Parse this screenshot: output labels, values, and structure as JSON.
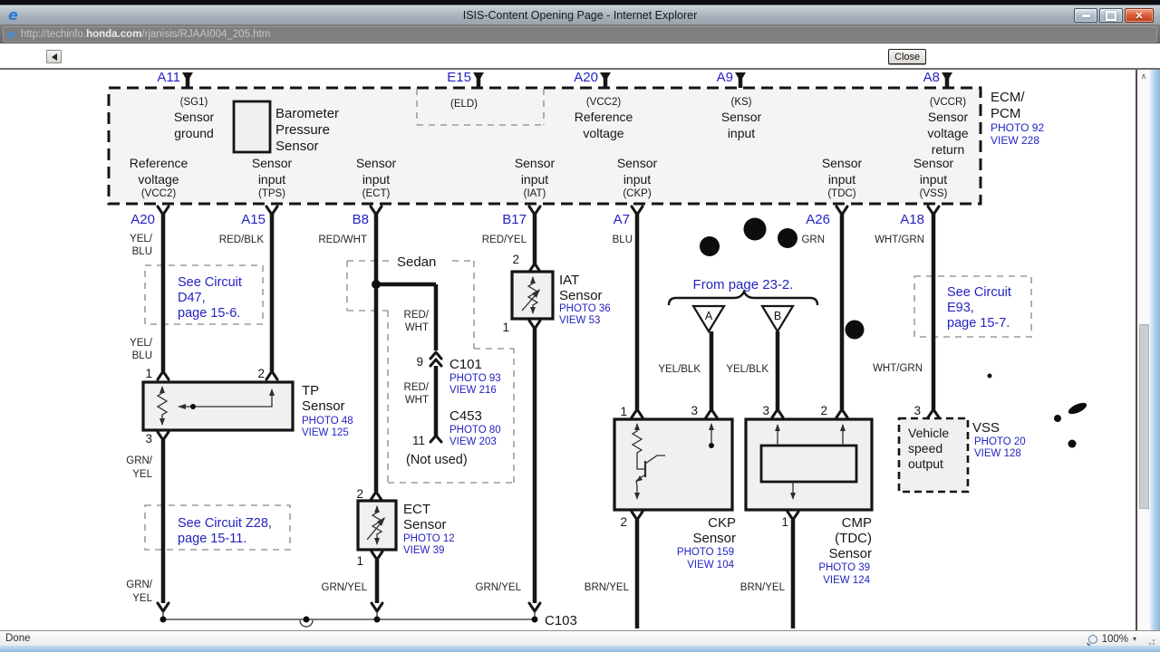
{
  "titlebar": {
    "title": "ISIS-Content Opening Page - Internet Explorer"
  },
  "addressbar": {
    "url_pre": "http://techinfo.",
    "url_domain": "honda.com",
    "url_path": "/rjanisis/RJAAI004_205.htm"
  },
  "toolbar": {
    "close": "Close"
  },
  "statusbar": {
    "done": "Done",
    "zoom": "100%"
  },
  "icons": {
    "ie": "e",
    "close": "✕",
    "scroll_up": "∧",
    "dropdown": "▾"
  },
  "ecm": {
    "title1": "ECM/",
    "title2": "PCM",
    "photo": "PHOTO 92",
    "view": "VIEW 228",
    "top_pins": [
      "A11",
      "E15",
      "A20",
      "A9",
      "A8"
    ],
    "bottom_pins": [
      "A20",
      "A15",
      "B8",
      "B17",
      "A7",
      "A26",
      "A18"
    ],
    "sg1": [
      "(SG1)",
      "Sensor",
      "ground"
    ],
    "baro": [
      "Barometer",
      "Pressure",
      "Sensor"
    ],
    "eld": "(ELD)",
    "vcc2_top": [
      "(VCC2)",
      "Reference",
      "voltage"
    ],
    "ks": [
      "(KS)",
      "Sensor",
      "input"
    ],
    "vccr": [
      "(VCCR)",
      "Sensor",
      "voltage",
      "return"
    ],
    "bottom_labels": [
      [
        "Reference",
        "voltage",
        "(VCC2)"
      ],
      [
        "Sensor",
        "input",
        "(TPS)"
      ],
      [
        "Sensor",
        "input",
        "(ECT)"
      ],
      [
        "Sensor",
        "input",
        "(IAT)"
      ],
      [
        "Sensor",
        "input",
        "(CKP)"
      ],
      [
        "Sensor",
        "input",
        "(TDC)"
      ],
      [
        "Sensor",
        "input",
        "(VSS)"
      ]
    ]
  },
  "wires": {
    "yel_blu": [
      "YEL/",
      "BLU"
    ],
    "red_blk": "RED/BLK",
    "red_wht": "RED/WHT",
    "red_yel": "RED/YEL",
    "blu": "BLU",
    "grn": "GRN",
    "wht_grn": "WHT/GRN",
    "yel_blk": "YEL/BLK",
    "red_wht2": [
      "RED/",
      "WHT"
    ],
    "grn_yel2": [
      "GRN/",
      "YEL"
    ],
    "grn_yel": "GRN/YEL",
    "brn_yel": "BRN/YEL"
  },
  "notes": {
    "d47": [
      "See Circuit",
      "D47,",
      "page 15-6."
    ],
    "z28": [
      "See Circuit Z28,",
      "page 15-11."
    ],
    "e93": [
      "See Circuit",
      "E93,",
      "page 15-7."
    ],
    "from_page": "From page 23-2.",
    "sedan": "Sedan",
    "not_used": "(Not used)"
  },
  "components": {
    "tp": {
      "l1": "TP",
      "l2": "Sensor",
      "photo": "PHOTO 48",
      "view": "VIEW 125"
    },
    "ect": {
      "l1": "ECT",
      "l2": "Sensor",
      "photo": "PHOTO 12",
      "view": "VIEW 39"
    },
    "iat": {
      "l1": "IAT",
      "l2": "Sensor",
      "photo": "PHOTO 36",
      "view": "VIEW 53"
    },
    "ckp": {
      "l1": "CKP",
      "l2": "Sensor",
      "photo": "PHOTO 159",
      "view": "VIEW 104"
    },
    "cmp": {
      "l1": "CMP",
      "l2": "(TDC)",
      "l3": "Sensor",
      "photo": "PHOTO 39",
      "view": "VIEW 124"
    },
    "vss": {
      "l1": "VSS",
      "photo": "PHOTO 20",
      "view": "VIEW 128",
      "box": [
        "Vehicle",
        "speed",
        "output"
      ]
    },
    "c101": {
      "name": "C101",
      "photo": "PHOTO 93",
      "view": "VIEW 216"
    },
    "c453": {
      "name": "C453",
      "photo": "PHOTO 80",
      "view": "VIEW 203"
    },
    "c103": "C103"
  },
  "pins": {
    "p1": "1",
    "p2": "2",
    "p3": "3",
    "p9": "9",
    "p11": "11"
  },
  "tri": {
    "a": "A",
    "b": "B"
  }
}
